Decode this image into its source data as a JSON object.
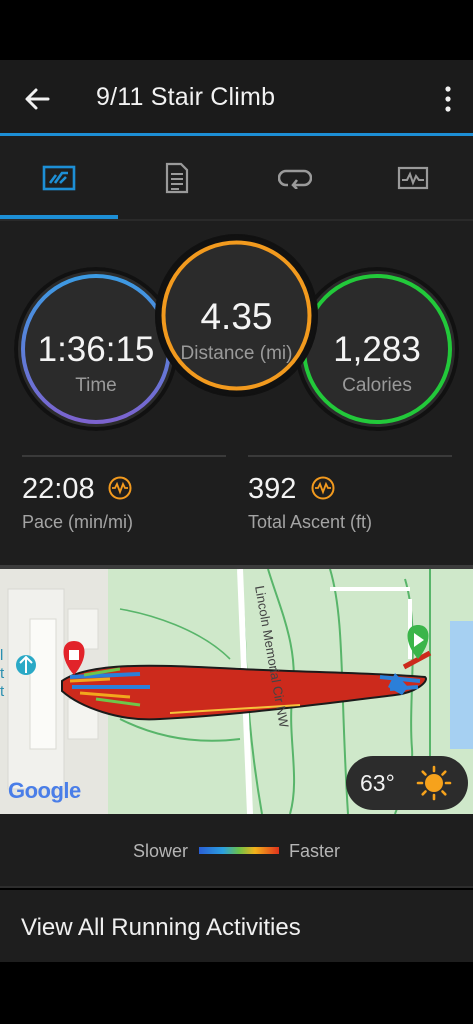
{
  "header": {
    "title": "9/11 Stair Climb"
  },
  "tabs": [
    {
      "icon": "stats-chart-icon",
      "active": true
    },
    {
      "icon": "details-document-icon",
      "active": false
    },
    {
      "icon": "laps-loop-icon",
      "active": false
    },
    {
      "icon": "graph-chart-icon",
      "active": false
    }
  ],
  "stats": {
    "time": {
      "value": "1:36:15",
      "label": "Time",
      "color": "#7b6fd0"
    },
    "distance": {
      "value": "4.35",
      "label": "Distance (mi)",
      "color": "#f29a1e"
    },
    "calories": {
      "value": "1,283",
      "label": "Calories",
      "color": "#22c93a"
    },
    "pace": {
      "value": "22:08",
      "label": "Pace (min/mi)"
    },
    "ascent": {
      "value": "392",
      "label": "Total Ascent (ft)"
    }
  },
  "map": {
    "road_label": "Lincoln Memorial Cir NW",
    "google_label": "Google",
    "edge_text": [
      "l",
      "t",
      "t"
    ],
    "weather_temp": "63°"
  },
  "legend": {
    "slower": "Slower",
    "faster": "Faster"
  },
  "footer": {
    "view_all": "View All Running Activities"
  },
  "colors": {
    "accent": "#1d8fd6",
    "icon_orange": "#f29a1e"
  }
}
